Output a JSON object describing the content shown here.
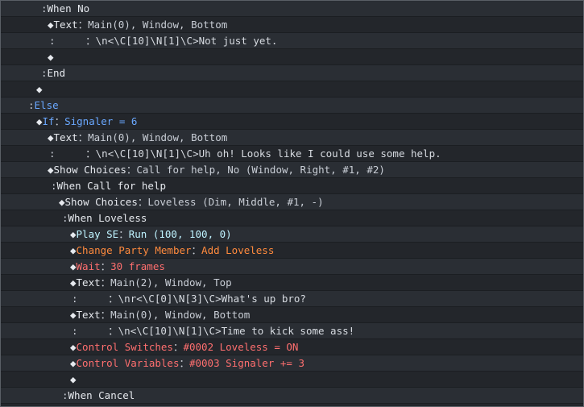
{
  "lines": [
    {
      "indent": 50,
      "parts": [
        {
          "t": ":",
          "c": "dim"
        },
        {
          "t": "When No",
          "c": "kw"
        }
      ]
    },
    {
      "indent": 58,
      "parts": [
        {
          "t": "◆",
          "c": "kw"
        },
        {
          "t": "Text",
          "c": "kw"
        },
        {
          "t": "：",
          "c": "dim"
        },
        {
          "t": "Main(0), Window, Bottom",
          "c": "param"
        }
      ]
    },
    {
      "indent": 60,
      "parts": [
        {
          "t": ":",
          "c": "dim"
        },
        {
          "t": "     ：\\n<\\C[10]\\N[1]\\C>Not just yet.",
          "c": "msg"
        }
      ]
    },
    {
      "indent": 58,
      "parts": [
        {
          "t": "◆",
          "c": "kw"
        }
      ]
    },
    {
      "indent": 50,
      "parts": [
        {
          "t": ":",
          "c": "dim"
        },
        {
          "t": "End",
          "c": "kw"
        }
      ]
    },
    {
      "indent": 44,
      "parts": [
        {
          "t": "◆",
          "c": "kw"
        }
      ]
    },
    {
      "indent": 34,
      "parts": [
        {
          "t": ":",
          "c": "dim"
        },
        {
          "t": "Else",
          "c": "blue"
        }
      ]
    },
    {
      "indent": 44,
      "parts": [
        {
          "t": "◆",
          "c": "kw"
        },
        {
          "t": "If",
          "c": "blue"
        },
        {
          "t": "：",
          "c": "dim"
        },
        {
          "t": "Signaler = 6",
          "c": "blue"
        }
      ]
    },
    {
      "indent": 58,
      "parts": [
        {
          "t": "◆",
          "c": "kw"
        },
        {
          "t": "Text",
          "c": "kw"
        },
        {
          "t": "：",
          "c": "dim"
        },
        {
          "t": "Main(0), Window, Bottom",
          "c": "param"
        }
      ]
    },
    {
      "indent": 60,
      "parts": [
        {
          "t": ":",
          "c": "dim"
        },
        {
          "t": "     ：\\n<\\C[10]\\N[1]\\C>Uh oh! Looks like I could use some help.",
          "c": "msg"
        }
      ]
    },
    {
      "indent": 58,
      "parts": [
        {
          "t": "◆",
          "c": "kw"
        },
        {
          "t": "Show Choices",
          "c": "kw"
        },
        {
          "t": "：",
          "c": "dim"
        },
        {
          "t": "Call for help, No (Window, Right, #1, #2)",
          "c": "param"
        }
      ]
    },
    {
      "indent": 62,
      "parts": [
        {
          "t": ":",
          "c": "dim"
        },
        {
          "t": "When Call for help",
          "c": "kw"
        }
      ]
    },
    {
      "indent": 72,
      "parts": [
        {
          "t": "◆",
          "c": "kw"
        },
        {
          "t": "Show Choices",
          "c": "kw"
        },
        {
          "t": "：",
          "c": "dim"
        },
        {
          "t": "Loveless (Dim, Middle, #1, -)",
          "c": "param"
        }
      ]
    },
    {
      "indent": 76,
      "parts": [
        {
          "t": ":",
          "c": "dim"
        },
        {
          "t": "When Loveless",
          "c": "kw"
        }
      ]
    },
    {
      "indent": 86,
      "parts": [
        {
          "t": "◆",
          "c": "kw"
        },
        {
          "t": "Play SE",
          "c": "cyan"
        },
        {
          "t": "：",
          "c": "dim"
        },
        {
          "t": "Run (100, 100, 0)",
          "c": "cyan"
        }
      ]
    },
    {
      "indent": 86,
      "parts": [
        {
          "t": "◆",
          "c": "kw"
        },
        {
          "t": "Change Party Member",
          "c": "orange"
        },
        {
          "t": "：",
          "c": "dim"
        },
        {
          "t": "Add Loveless",
          "c": "orange"
        }
      ]
    },
    {
      "indent": 86,
      "parts": [
        {
          "t": "◆",
          "c": "kw"
        },
        {
          "t": "Wait",
          "c": "red"
        },
        {
          "t": "：",
          "c": "dim"
        },
        {
          "t": "30 frames",
          "c": "red"
        }
      ]
    },
    {
      "indent": 86,
      "parts": [
        {
          "t": "◆",
          "c": "kw"
        },
        {
          "t": "Text",
          "c": "kw"
        },
        {
          "t": "：",
          "c": "dim"
        },
        {
          "t": "Main(2), Window, Top",
          "c": "param"
        }
      ]
    },
    {
      "indent": 88,
      "parts": [
        {
          "t": ":",
          "c": "dim"
        },
        {
          "t": "     ：\\nr<\\C[0]\\N[3]\\C>What's up bro?",
          "c": "msg"
        }
      ]
    },
    {
      "indent": 86,
      "parts": [
        {
          "t": "◆",
          "c": "kw"
        },
        {
          "t": "Text",
          "c": "kw"
        },
        {
          "t": "：",
          "c": "dim"
        },
        {
          "t": "Main(0), Window, Bottom",
          "c": "param"
        }
      ]
    },
    {
      "indent": 88,
      "parts": [
        {
          "t": ":",
          "c": "dim"
        },
        {
          "t": "     ：\\n<\\C[10]\\N[1]\\C>Time to kick some ass!",
          "c": "msg"
        }
      ]
    },
    {
      "indent": 86,
      "parts": [
        {
          "t": "◆",
          "c": "kw"
        },
        {
          "t": "Control Switches",
          "c": "red"
        },
        {
          "t": "：",
          "c": "dim"
        },
        {
          "t": "#0002 Loveless = ON",
          "c": "red"
        }
      ]
    },
    {
      "indent": 86,
      "parts": [
        {
          "t": "◆",
          "c": "kw"
        },
        {
          "t": "Control Variables",
          "c": "red"
        },
        {
          "t": "：",
          "c": "dim"
        },
        {
          "t": "#0003 Signaler += 3",
          "c": "red"
        }
      ]
    },
    {
      "indent": 86,
      "parts": [
        {
          "t": "◆",
          "c": "kw"
        }
      ]
    },
    {
      "indent": 76,
      "parts": [
        {
          "t": ":",
          "c": "dim"
        },
        {
          "t": "When Cancel",
          "c": "kw"
        }
      ]
    }
  ]
}
